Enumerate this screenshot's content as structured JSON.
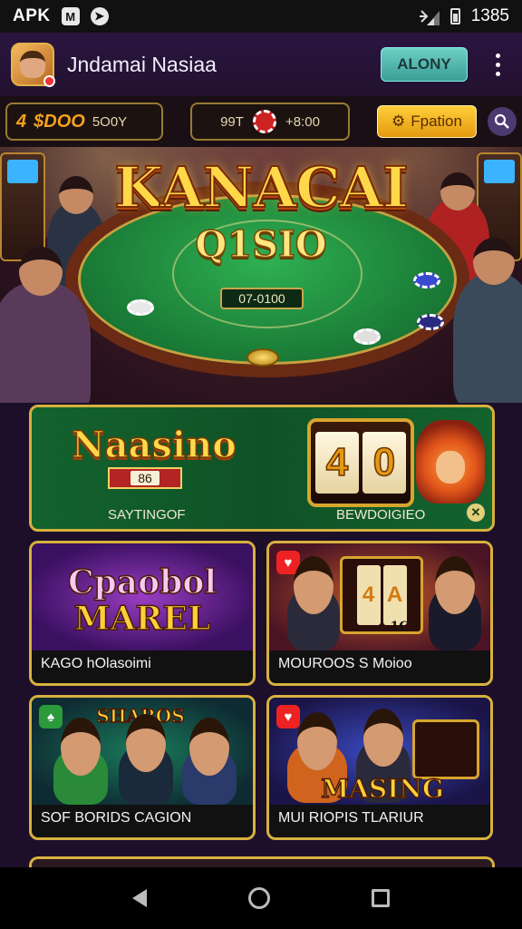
{
  "status_bar": {
    "left_label": "APK",
    "time": "1385",
    "icons": [
      "m-app-icon",
      "arrow-app-icon",
      "signal-icon",
      "battery-icon"
    ]
  },
  "app_bar": {
    "title": "Jndamai Nasiaa",
    "primary_button": "ALONY",
    "icons": [
      "avatar",
      "more-vert-icon"
    ]
  },
  "toolbar": {
    "balance_highlight": "$DOO",
    "balance_prefix": "4",
    "balance_suffix": "5O0Y",
    "counter_left": "99T",
    "counter_right": "+8:00",
    "action_button": "Fpation",
    "icons": [
      "coin-icon",
      "chip-icon",
      "gear-icon",
      "search-icon"
    ]
  },
  "hero": {
    "title": "KANACAI",
    "subtitle": "Q1SIO",
    "table_sign": "07-0100"
  },
  "featured": {
    "logo": "Naasino",
    "ribbon": "86",
    "reels": [
      "4",
      "0"
    ],
    "caption_left": "SAYTINGOF",
    "caption_right": "BEWDOIGIEO"
  },
  "games": [
    {
      "art_line1": "Cpaobol",
      "art_line2": "MAREL",
      "caption": "KAGO hOlasoimi"
    },
    {
      "art_reels": [
        "4",
        "A"
      ],
      "art_label": "1C",
      "caption": "MOUROOS S Moioo"
    },
    {
      "art_banner": "SHAROS",
      "caption": "SOF BORIDS CAGION"
    },
    {
      "art_line1": "MASING",
      "caption": "MUI RIOPIS TLARIUR"
    }
  ],
  "nav": {
    "icons": [
      "back-icon",
      "home-icon",
      "recents-icon"
    ]
  },
  "colors": {
    "gold_border": "#d7b13e",
    "felt_green": "#1c8038",
    "header_purple": "#2a1540",
    "accent_teal": "#6fd0c4",
    "accent_yellow": "#ffce3a"
  }
}
